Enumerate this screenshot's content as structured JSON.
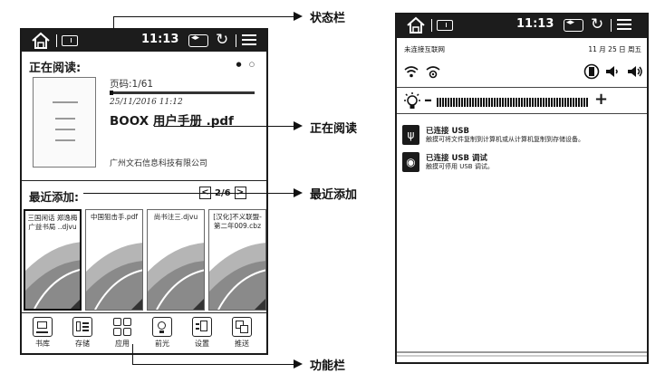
{
  "left_device": {
    "status_bar": {
      "time": "11:13"
    },
    "reading": {
      "section_title": "正在阅读:",
      "page_info": "页码:1/61",
      "progress": 0.02,
      "date": "25/11/2016 11:12",
      "book_title": "BOOX 用户手册 .pdf",
      "publisher": "广州文石信息科技有限公司"
    },
    "recent": {
      "section_title": "最近添加:",
      "page_count": "2/6",
      "prev_glyph": "<",
      "next_glyph": ">",
      "items": [
        {
          "name": "三国闲话 郑逸梅 广益书局 ..djvu"
        },
        {
          "name": "中国狙击手.pdf"
        },
        {
          "name": "尚书注三.djvu"
        },
        {
          "name": "[汉化]不义联盟-第二年009.cbz"
        }
      ]
    },
    "function_bar": [
      {
        "label": "书库",
        "icon": "library-icon"
      },
      {
        "label": "存储",
        "icon": "storage-icon"
      },
      {
        "label": "应用",
        "icon": "apps-icon"
      },
      {
        "label": "前光",
        "icon": "frontlight-icon"
      },
      {
        "label": "设置",
        "icon": "settings-icon"
      },
      {
        "label": "推送",
        "icon": "push-icon"
      }
    ]
  },
  "annotations": {
    "status_bar": "状态栏",
    "now_reading": "正在阅读",
    "recently_added": "最近添加",
    "function_bar": "功能栏"
  },
  "right_device": {
    "status_bar": {
      "time": "11:13"
    },
    "network_status": "未连接互联网",
    "date_status": "11 月 25 日 周五",
    "light": {
      "minus": "–",
      "plus": "+"
    },
    "notifications": [
      {
        "title": "已连接 USB",
        "description": "触摸可将文件复制到计算机或从计算机复制到存储设备。",
        "icon": "usb-icon"
      },
      {
        "title": "已连接 USB 调试",
        "description": "触摸可停用 USB 调试。",
        "icon": "android-debug-icon"
      }
    ]
  }
}
